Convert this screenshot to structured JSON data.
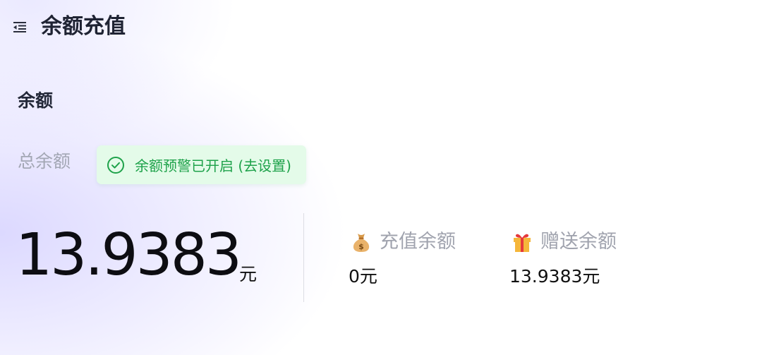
{
  "header": {
    "title": "余额充值",
    "menu_icon": "indent-menu-icon"
  },
  "balance": {
    "section_title": "余额",
    "total_label": "总余额",
    "alert_text": "余额预警已开启 (去设置)",
    "total_amount": "13.9383",
    "total_unit": "元",
    "recharge_label": "充值余额",
    "recharge_value": "0元",
    "gift_label": "赠送余额",
    "gift_value": "13.9383元"
  },
  "colors": {
    "alert_green": "#1ea24a",
    "alert_bg": "#e4fbe9",
    "muted_text": "#a0a3ae"
  }
}
